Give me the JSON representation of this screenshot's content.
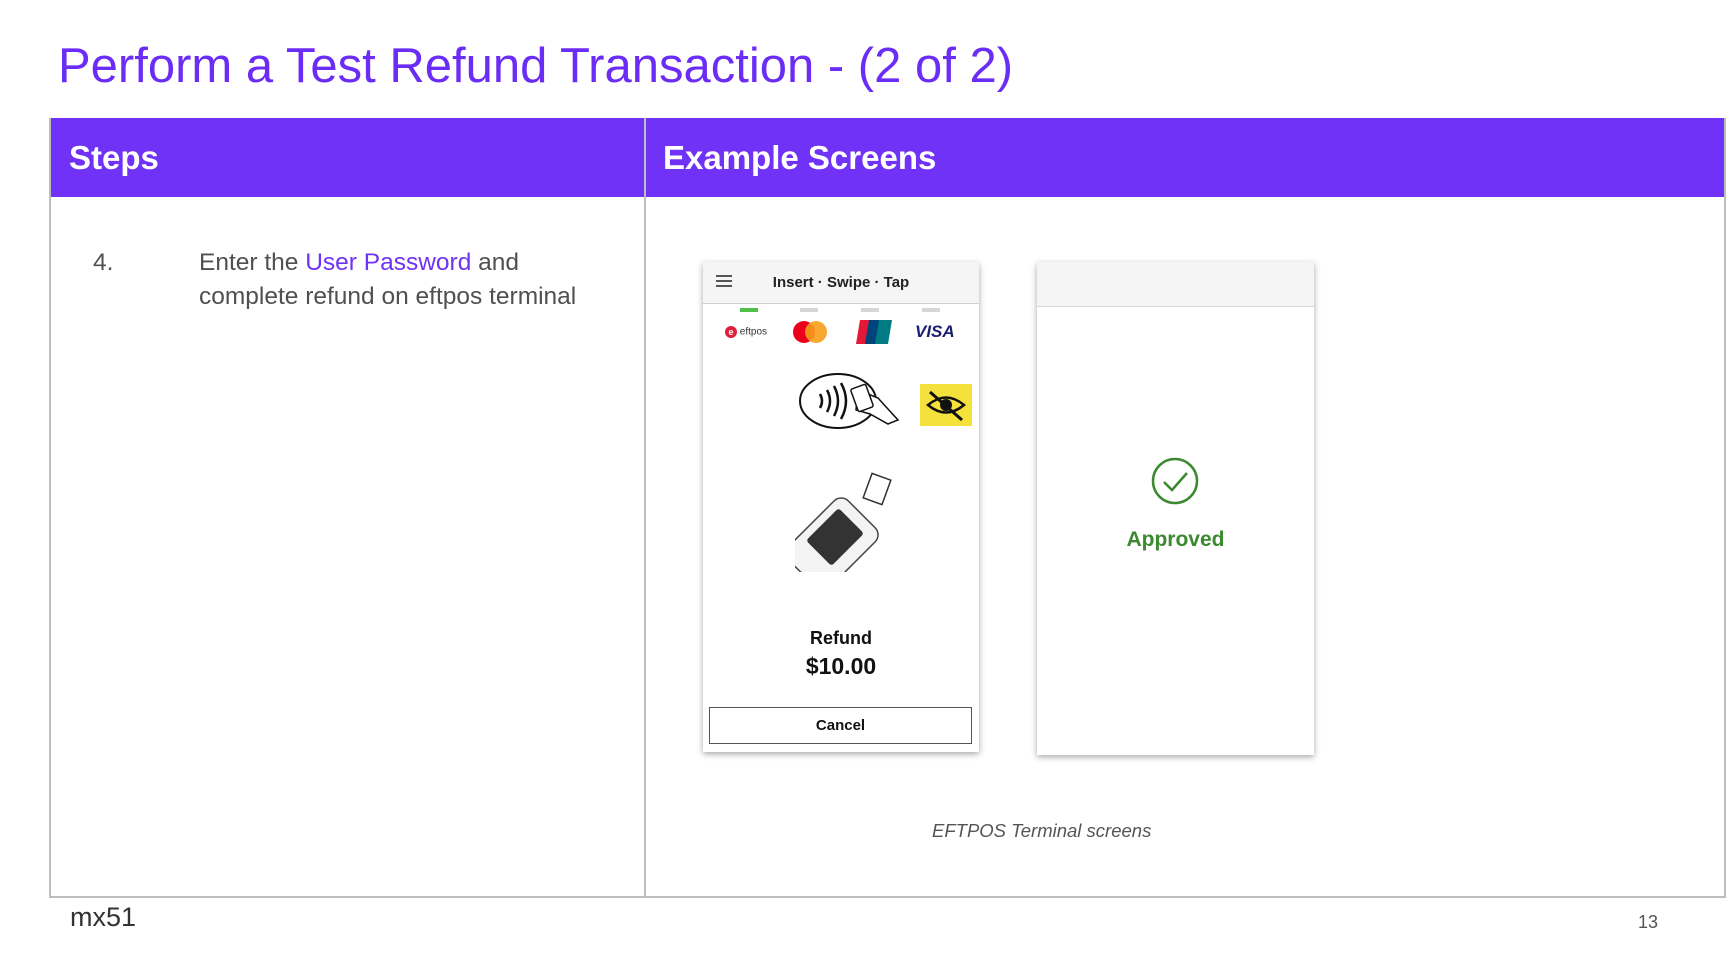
{
  "title": "Perform a Test Refund Transaction - (2 of 2)",
  "table": {
    "headers": {
      "steps": "Steps",
      "screens": "Example Screens"
    },
    "step": {
      "number": "4.",
      "text_before": "Enter the ",
      "highlight": "User Password",
      "text_after": " and complete refund on eftpos terminal"
    }
  },
  "terminal1": {
    "header_title": "Insert · Swipe · Tap",
    "card_logos": [
      "eftpos",
      "mastercard",
      "unionpay",
      "VISA"
    ],
    "eftpos_label": "eftpos",
    "visa_label": "VISA",
    "transaction_type": "Refund",
    "amount": "$10.00",
    "cancel_label": "Cancel"
  },
  "terminal2": {
    "status": "Approved",
    "status_color": "#3b8a2f"
  },
  "caption": "EFTPOS Terminal screens",
  "footer": {
    "brand": "mx51",
    "page_number": "13"
  },
  "colors": {
    "accent": "#6f32f6",
    "title": "#6b2cf5"
  }
}
